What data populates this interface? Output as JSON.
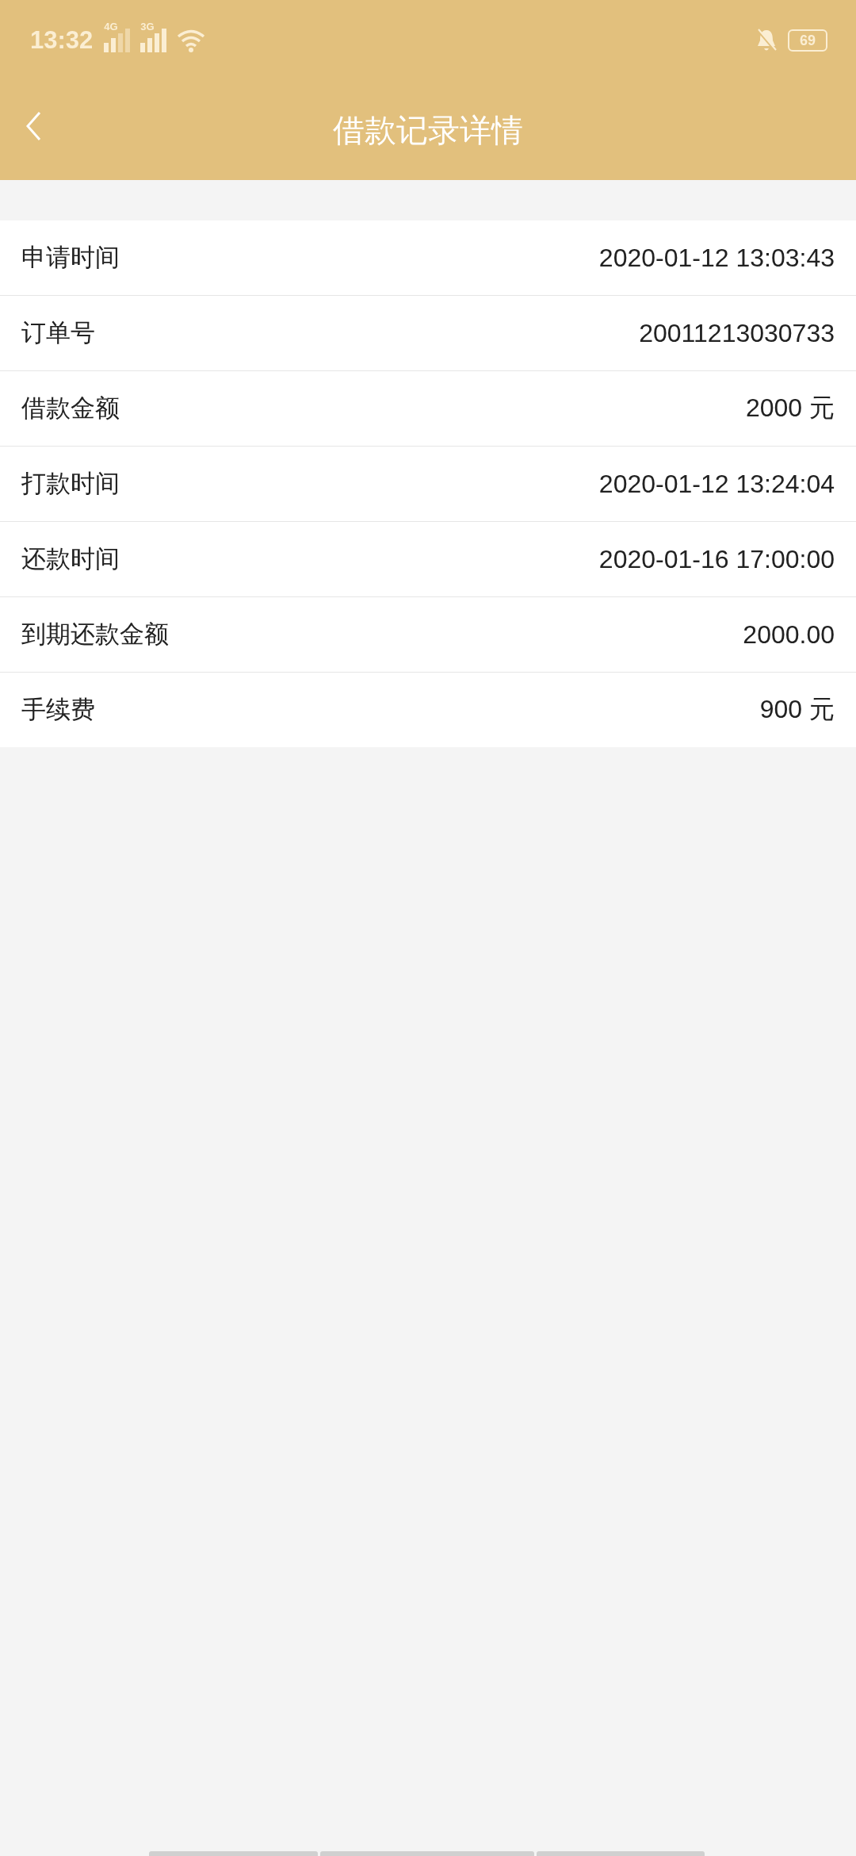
{
  "status_bar": {
    "time": "13:32",
    "signals": [
      {
        "label": "4G"
      },
      {
        "label": "3G"
      }
    ],
    "battery": "69"
  },
  "header": {
    "title": "借款记录详情"
  },
  "details": [
    {
      "label": "申请时间",
      "value": "2020-01-12 13:03:43"
    },
    {
      "label": "订单号",
      "value": "20011213030733"
    },
    {
      "label": "借款金额",
      "value": "2000 元"
    },
    {
      "label": "打款时间",
      "value": "2020-01-12 13:24:04"
    },
    {
      "label": "还款时间",
      "value": "2020-01-16 17:00:00"
    },
    {
      "label": "到期还款金额",
      "value": "2000.00"
    },
    {
      "label": "手续费",
      "value": "900 元"
    }
  ]
}
